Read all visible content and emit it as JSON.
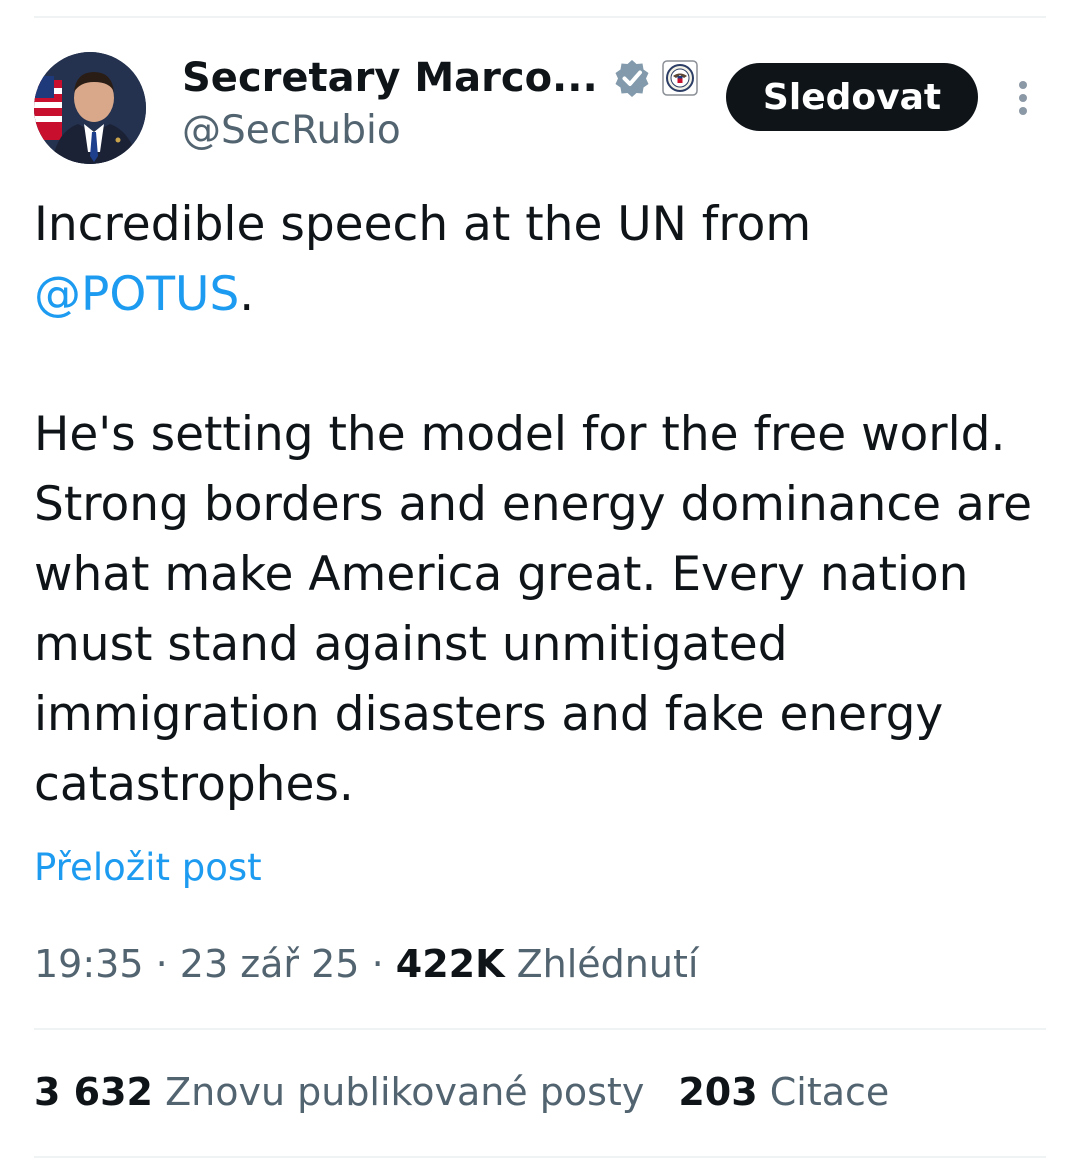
{
  "user": {
    "display_name": "Secretary Marco...",
    "handle": "@SecRubio",
    "verified_badge_icon": "verified-badge-icon",
    "affiliation_icon": "state-department-seal-icon"
  },
  "actions": {
    "follow_label": "Sledovat",
    "more_icon": "more-vertical-icon"
  },
  "tweet": {
    "line1": "Incredible speech at the UN from",
    "mention": "@POTUS",
    "mention_suffix": ".",
    "paragraph2": "He's setting the model for the free world. Strong borders and energy dominance are what make America great. Every nation must stand against unmitigated immigration disasters and fake energy catastrophes."
  },
  "translate_label": "Přeložit post",
  "meta": {
    "time": "19:35",
    "date": "23 zář 25",
    "views_count": "422K",
    "views_label": "Zhlédnutí",
    "separator": " · "
  },
  "stats": {
    "reposts_count": "3 632",
    "reposts_label": "Znovu publikované posty",
    "quotes_count": "203",
    "quotes_label": "Citace"
  },
  "colors": {
    "text": "#0f1419",
    "secondary": "#536471",
    "link": "#1d9bf0",
    "button_bg": "#0f1419",
    "verified_badge": "#829aab"
  }
}
